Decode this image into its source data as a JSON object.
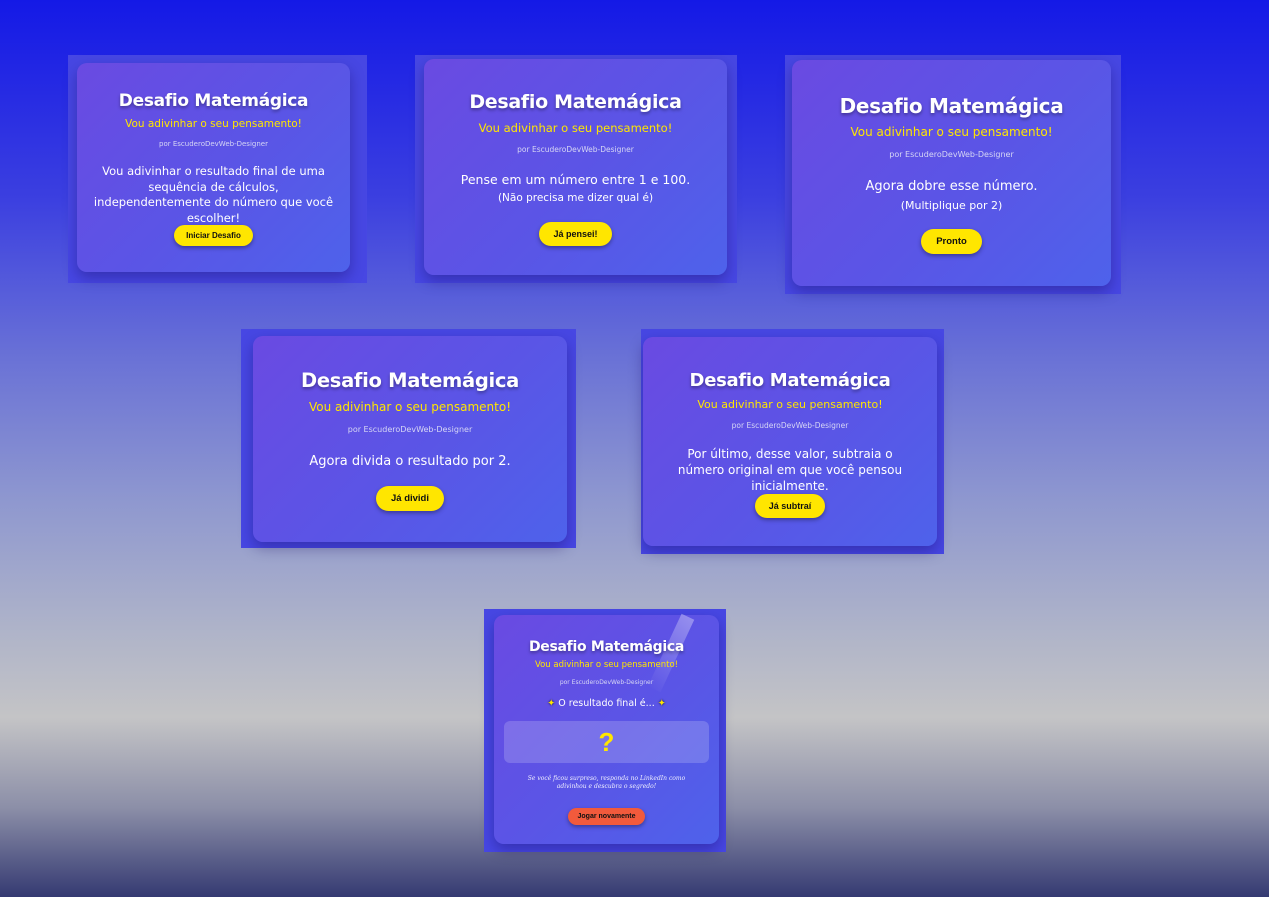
{
  "brand": {
    "title": "Desafio Matemágica",
    "subtitle": "Vou adivinhar o seu pensamento!",
    "author": "por EscuderoDevWeb-Designer"
  },
  "colors": {
    "accent": "#ffe600",
    "button_orange": "#f25a3c",
    "card_start": "#6a4ae2",
    "card_end": "#4e62eb"
  },
  "steps": [
    {
      "text": "Vou adivinhar o resultado final de uma sequência de cálculos, independentemente do número que você escolher!",
      "button": "Iniciar Desafio"
    },
    {
      "text": "Pense em um número entre 1 e 100.",
      "hint": "(Não precisa me dizer qual é)",
      "button": "Já pensei!"
    },
    {
      "text": "Agora dobre esse número.",
      "hint": "(Multiplique por 2)",
      "button": "Pronto"
    },
    {
      "text": "Agora divida o resultado por 2.",
      "button": "Já dividi"
    },
    {
      "text": "Por último, desse valor, subtraia o número original em que você pensou inicialmente.",
      "button": "Já subtraí"
    },
    {
      "text": "O resultado final é...",
      "sparkle_icon": "sparkle-icon",
      "result": "?",
      "note": "Se você ficou surpreso, responda no LinkedIn como adivinhou e descubra o segredo!",
      "button": "Jogar novamente"
    }
  ]
}
